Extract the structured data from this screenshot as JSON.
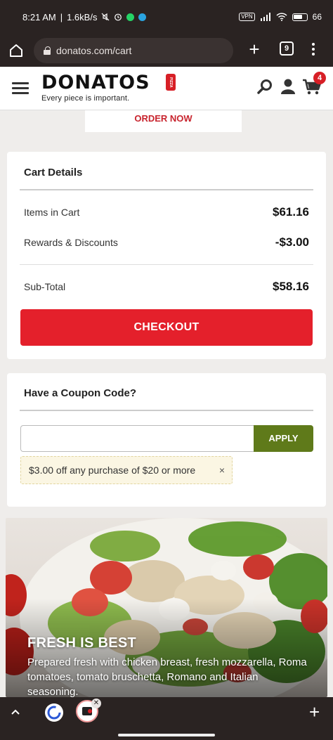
{
  "status_bar": {
    "time": "8:21 AM",
    "speed": "1.6kB/s",
    "vpn": "VPN",
    "battery": "66"
  },
  "browser": {
    "url": "donatos.com/cart",
    "tab_count": "9"
  },
  "header": {
    "brand": "DONATOS",
    "brand_badge": "PIZZA",
    "tagline": "Every piece is important.",
    "cart_count": "4"
  },
  "order_now": "ORDER NOW",
  "cart_details": {
    "title": "Cart Details",
    "items_label": "Items in Cart",
    "items_value": "$61.16",
    "discounts_label": "Rewards & Discounts",
    "discounts_value": "-$3.00",
    "subtotal_label": "Sub-Total",
    "subtotal_value": "$58.16",
    "checkout_label": "CHECKOUT"
  },
  "coupon": {
    "title": "Have a Coupon Code?",
    "input_value": "",
    "apply_label": "APPLY",
    "applied_text": "$3.00 off any purchase of $20 or more",
    "remove_symbol": "×"
  },
  "promo": {
    "title": "FRESH IS BEST",
    "description": "Prepared fresh with chicken breast, fresh mozzarella, Roma tomatoes, tomato bruschetta, Romano and Italian seasoning."
  },
  "colors": {
    "brand_red": "#e4202b",
    "apply_green": "#5f7a1a",
    "chrome_dark": "#2a2322"
  }
}
